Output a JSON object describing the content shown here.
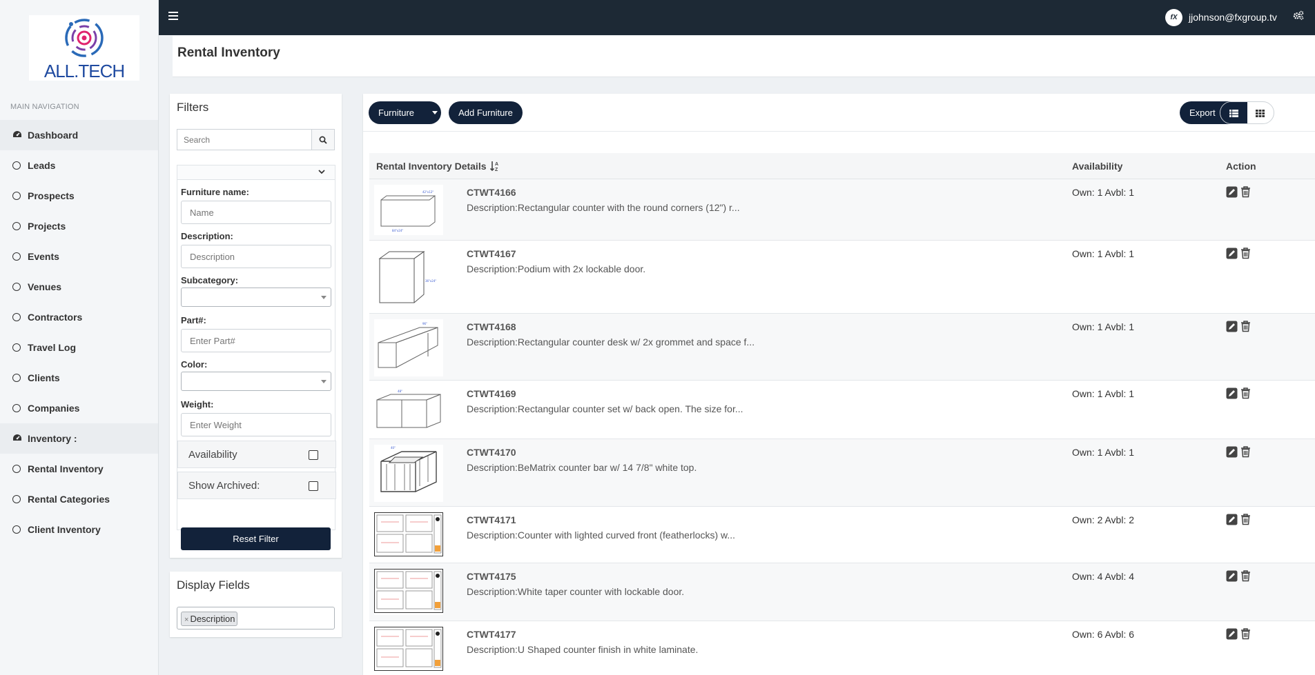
{
  "app": {
    "logo_text": "ALL.TECH",
    "user_email": "jjohnson@fxgroup.tv",
    "user_avatar_text": "fX",
    "brand_color": "#12223a",
    "topbar_color": "#1d2935"
  },
  "sidebar": {
    "header": "MAIN NAVIGATION",
    "items": [
      {
        "label": "Dashboard",
        "icon": "dashboard-icon"
      },
      {
        "label": "Leads",
        "icon": "circle-icon"
      },
      {
        "label": "Prospects",
        "icon": "circle-icon"
      },
      {
        "label": "Projects",
        "icon": "circle-icon"
      },
      {
        "label": "Events",
        "icon": "circle-icon"
      },
      {
        "label": "Venues",
        "icon": "circle-icon"
      },
      {
        "label": "Contractors",
        "icon": "circle-icon"
      },
      {
        "label": "Travel Log",
        "icon": "circle-icon"
      },
      {
        "label": "Clients",
        "icon": "circle-icon"
      },
      {
        "label": "Companies",
        "icon": "circle-icon"
      },
      {
        "label": "Inventory :",
        "icon": "dashboard-icon"
      },
      {
        "label": "Rental Inventory",
        "icon": "circle-icon"
      },
      {
        "label": "Rental Categories",
        "icon": "circle-icon"
      },
      {
        "label": "Client Inventory",
        "icon": "circle-icon"
      }
    ]
  },
  "page": {
    "title": "Rental Inventory"
  },
  "filters": {
    "title": "Filters",
    "search_placeholder": "Search",
    "furniture_name_label": "Furniture name:",
    "furniture_name_placeholder": "Name",
    "description_label": "Description:",
    "description_placeholder": "Description",
    "subcategory_label": "Subcategory:",
    "subcategory_value": "",
    "part_label": "Part#:",
    "part_placeholder": "Enter Part#",
    "color_label": "Color:",
    "color_value": "",
    "weight_label": "Weight:",
    "weight_placeholder": "Enter Weight",
    "availability_label": "Availability",
    "availability_checked": false,
    "show_archived_label": "Show Archived:",
    "show_archived_checked": false,
    "reset_label": "Reset Filter"
  },
  "display_fields": {
    "title": "Display Fields",
    "tags": [
      "Description"
    ],
    "remove_glyph": "×"
  },
  "toolbar": {
    "furniture_label": "Furniture",
    "add_label": "Add Furniture",
    "export_label": "Export"
  },
  "table": {
    "headers": {
      "details": "Rental Inventory Details",
      "availability": "Availability",
      "action": "Action"
    },
    "rows": [
      {
        "code": "CTWT4166",
        "desc": "Description:Rectangular counter with the round corners (12\") r...",
        "avail": "Own: 1 Avbl: 1",
        "thumb": "counter-round"
      },
      {
        "code": "CTWT4167",
        "desc": "Description:Podium with 2x lockable door.",
        "avail": "Own: 1 Avbl: 1",
        "thumb": "podium"
      },
      {
        "code": "CTWT4168",
        "desc": "Description:Rectangular counter desk w/ 2x grommet and space f...",
        "avail": "Own: 1 Avbl: 1",
        "thumb": "desk"
      },
      {
        "code": "CTWT4169",
        "desc": "Description:Rectangular counter set w/ back open. The size for...",
        "avail": "Own: 1 Avbl: 1",
        "thumb": "counter-set"
      },
      {
        "code": "CTWT4170",
        "desc": "Description:BeMatrix counter bar w/ 14 7/8\" white top.",
        "avail": "Own: 1 Avbl: 1",
        "thumb": "bar"
      },
      {
        "code": "CTWT4171",
        "desc": "Description:Counter with lighted curved front (featherlocks) w...",
        "avail": "Own: 2 Avbl: 2",
        "thumb": "sheet"
      },
      {
        "code": "CTWT4175",
        "desc": "Description:White taper counter with lockable door.",
        "avail": "Own: 4 Avbl: 4",
        "thumb": "sheet"
      },
      {
        "code": "CTWT4177",
        "desc": "Description:U Shaped counter finish in white laminate.",
        "avail": "Own: 6 Avbl: 6",
        "thumb": "sheet"
      }
    ]
  }
}
